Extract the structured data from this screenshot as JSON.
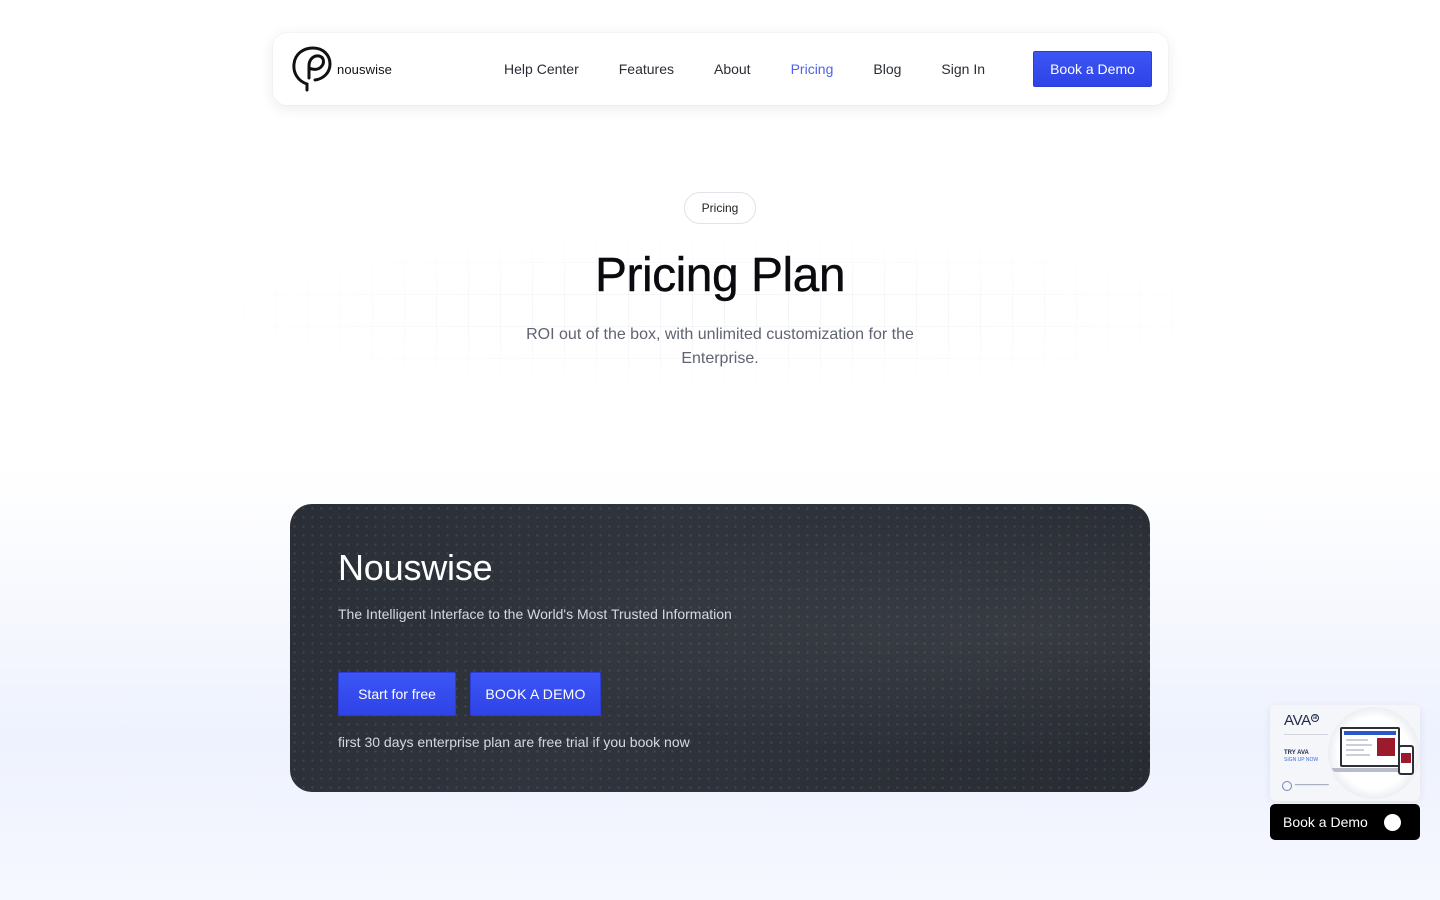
{
  "brand": {
    "name": "nouswise"
  },
  "nav": {
    "items": [
      {
        "label": "Help Center",
        "active": false
      },
      {
        "label": "Features",
        "active": false
      },
      {
        "label": "About",
        "active": false
      },
      {
        "label": "Pricing",
        "active": true
      },
      {
        "label": "Blog",
        "active": false
      },
      {
        "label": "Sign In",
        "active": false
      }
    ],
    "cta_label": "Book a Demo"
  },
  "hero": {
    "badge": "Pricing",
    "title": "Pricing Plan",
    "subtitle": "ROI out of the box, with unlimited customization for the Enterprise."
  },
  "plan": {
    "name": "Nouswise",
    "description": "The Intelligent Interface to the World's Most Trusted Information",
    "primary_button": "Start for free",
    "secondary_button": "BOOK A DEMO",
    "note": "first 30 days enterprise plan are free trial if you book now"
  },
  "widget": {
    "promo": {
      "title": "AVA",
      "title_badge": "ai",
      "try_label": "TRY AVA",
      "signup_label": "SIGN UP NOW"
    },
    "button_label": "Book a Demo"
  },
  "colors": {
    "accent": "#3c56f5",
    "active_link": "#4f63e8",
    "card_bg": "#2d3139",
    "widget_bg": "#000000"
  },
  "icons": {
    "brand_logo": "head-profile-icon",
    "widget_toggle": "circle-dot-icon"
  }
}
